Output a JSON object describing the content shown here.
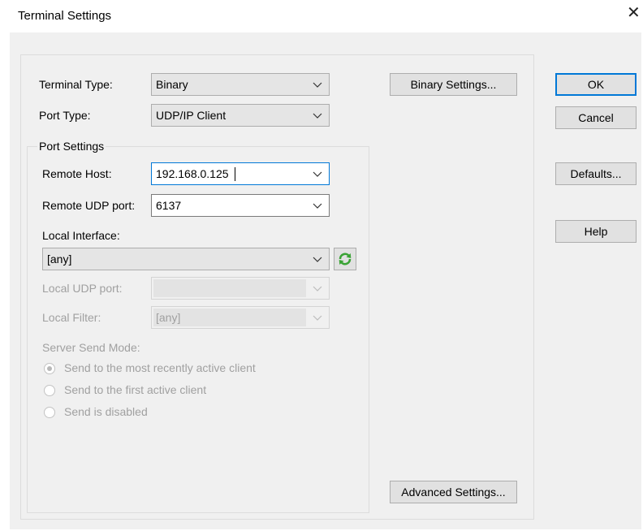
{
  "window": {
    "title": "Terminal Settings",
    "close_glyph": "✕"
  },
  "terminal_type": {
    "label": "Terminal Type:",
    "value": "Binary"
  },
  "port_type": {
    "label": "Port Type:",
    "value": "UDP/IP Client"
  },
  "port_settings": {
    "legend": "Port Settings",
    "remote_host": {
      "label": "Remote Host:",
      "value": "192.168.0.125"
    },
    "remote_udp_port": {
      "label": "Remote UDP port:",
      "value": "6137"
    },
    "local_interface": {
      "label": "Local Interface:",
      "value": "[any]",
      "refresh_icon": "refresh-icon"
    },
    "local_udp_port": {
      "label": "Local UDP port:",
      "value": ""
    },
    "local_filter": {
      "label": "Local Filter:",
      "value": "[any]"
    },
    "server_send_mode": {
      "label": "Server Send Mode:",
      "options": [
        {
          "label": "Send to the most recently active client",
          "selected": true
        },
        {
          "label": "Send to the first active client",
          "selected": false
        },
        {
          "label": "Send is disabled",
          "selected": false
        }
      ]
    }
  },
  "buttons": {
    "binary_settings": "Binary Settings...",
    "advanced_settings": "Advanced Settings...",
    "ok": "OK",
    "cancel": "Cancel",
    "defaults": "Defaults...",
    "help": "Help"
  },
  "colors": {
    "focus_border": "#0078d7",
    "refresh_icon": "#3aa335"
  }
}
